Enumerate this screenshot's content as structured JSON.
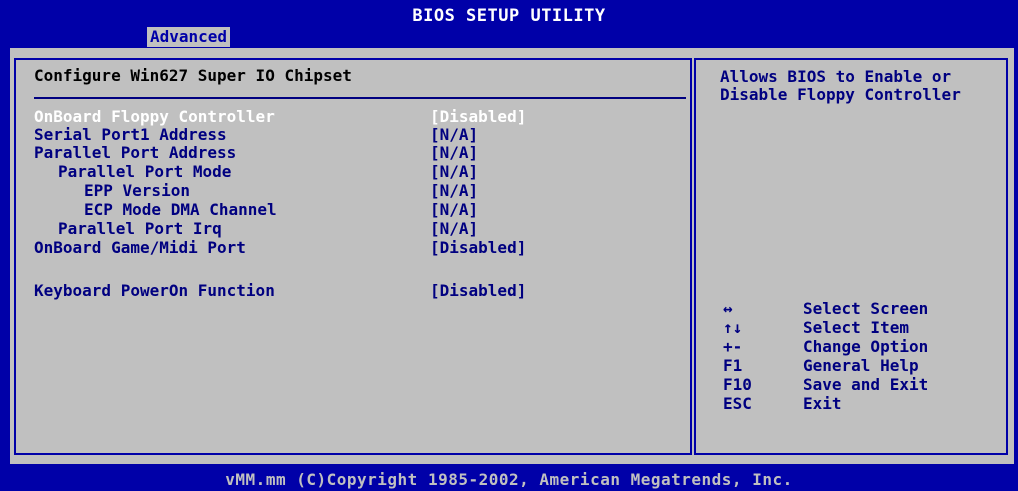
{
  "header": {
    "title": "BIOS SETUP UTILITY",
    "tab": "Advanced"
  },
  "section": {
    "title": "Configure Win627 Super IO Chipset"
  },
  "settings": [
    {
      "label": "OnBoard Floppy Controller",
      "value": "[Disabled]"
    },
    {
      "label": "Serial Port1 Address",
      "value": "[N/A]"
    },
    {
      "label": "Parallel Port Address",
      "value": "[N/A]"
    },
    {
      "label": "Parallel Port Mode",
      "value": "[N/A]"
    },
    {
      "label": "EPP Version",
      "value": "[N/A]"
    },
    {
      "label": "ECP Mode DMA Channel",
      "value": "[N/A]"
    },
    {
      "label": "Parallel Port Irq",
      "value": "[N/A]"
    },
    {
      "label": "OnBoard Game/Midi Port",
      "value": "[Disabled]"
    },
    {
      "label": "Keyboard PowerOn Function",
      "value": "[Disabled]"
    }
  ],
  "help": {
    "text": "Allows BIOS to Enable or Disable Floppy Controller"
  },
  "keys": [
    {
      "key": "↔",
      "action": "Select Screen"
    },
    {
      "key": "↑↓",
      "action": "Select Item"
    },
    {
      "key": "+-",
      "action": "Change Option"
    },
    {
      "key": "F1",
      "action": "General Help"
    },
    {
      "key": "F10",
      "action": "Save and Exit"
    },
    {
      "key": "ESC",
      "action": "Exit"
    }
  ],
  "footer": {
    "copyright": "vMM.mm (C)Copyright 1985-2002, American Megatrends, Inc."
  },
  "colors": {
    "blue": "#0000a8",
    "gray": "#c0c0c0",
    "text": "#000080",
    "selected": "#ffffff"
  }
}
